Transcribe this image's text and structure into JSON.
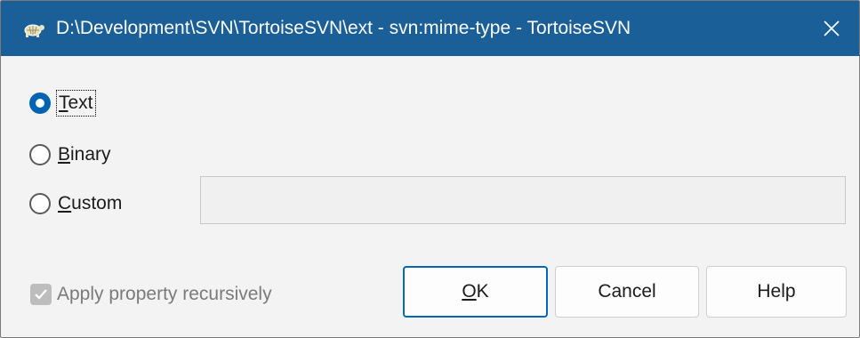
{
  "window": {
    "title": "D:\\Development\\SVN\\TortoiseSVN\\ext - svn:mime-type - TortoiseSVN",
    "app_icon": "tortoise-icon",
    "close_icon": "close-icon",
    "titlebar_color": "#1a5f97"
  },
  "mime_type": {
    "options": [
      {
        "label_first": "T",
        "label_rest": "ext",
        "selected": true
      },
      {
        "label_first": "B",
        "label_rest": "inary",
        "selected": false
      },
      {
        "label_first": "C",
        "label_rest": "ustom",
        "selected": false
      }
    ],
    "custom_value": ""
  },
  "apply_recursively": {
    "label": "Apply property recursively",
    "checked": true,
    "enabled": false
  },
  "buttons": {
    "ok_first": "O",
    "ok_rest": "K",
    "cancel": "Cancel",
    "help": "Help"
  },
  "accent_color": "#0063b1"
}
